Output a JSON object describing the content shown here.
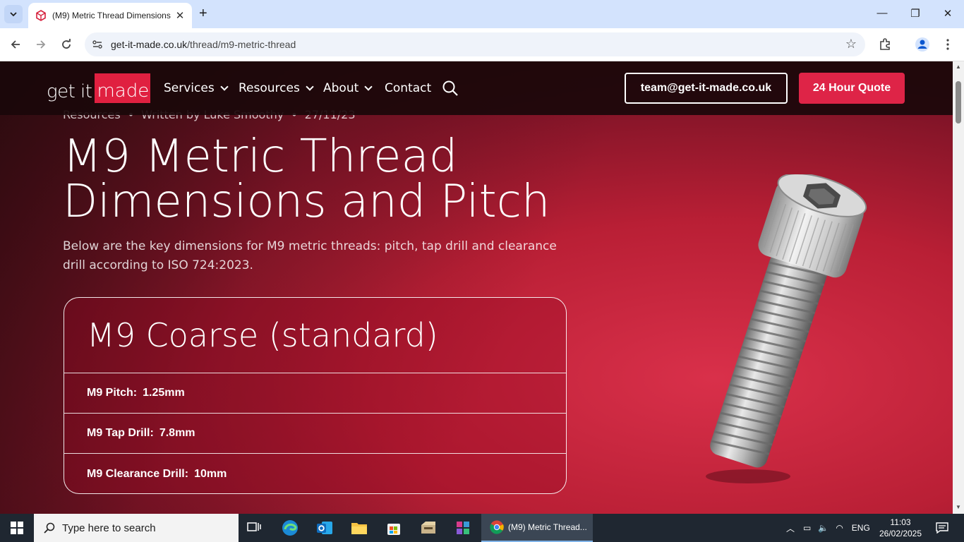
{
  "browser": {
    "tab_title": "(M9) Metric Thread Dimensions",
    "url_host": "get-it-made.co.uk",
    "url_path": "/thread/m9-metric-thread"
  },
  "site": {
    "logo_left": "get it",
    "logo_right": "made",
    "nav": [
      "Services",
      "Resources",
      "About",
      "Contact"
    ],
    "email_button": "team@get-it-made.co.uk",
    "quote_button": "24 Hour Quote"
  },
  "hero": {
    "meta_category": "Resources",
    "meta_author": "Written by  Luke Smoothy",
    "meta_date": "27/11/23",
    "title": "M9 Metric Thread Dimensions and Pitch",
    "subtitle": "Below are the key dimensions for M9 metric threads: pitch, tap drill and clearance drill according to ISO 724:2023."
  },
  "spec_card": {
    "title": "M9 Coarse (standard)",
    "rows": [
      {
        "label": "M9 Pitch:",
        "value": "1.25mm"
      },
      {
        "label": "M9 Tap Drill:",
        "value": "7.8mm"
      },
      {
        "label": "M9 Clearance Drill:",
        "value": "10mm"
      }
    ]
  },
  "taskbar": {
    "search_placeholder": "Type here to search",
    "chrome_label": "(M9) Metric Thread...",
    "language": "ENG",
    "time": "11:03",
    "date": "26/02/2025"
  },
  "colors": {
    "accent": "#de2447",
    "nav_bg": "#1a080a",
    "tabstrip": "#d3e3fd"
  }
}
